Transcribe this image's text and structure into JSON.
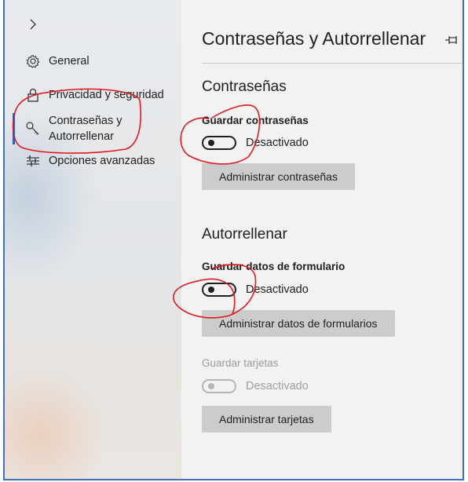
{
  "sidebar": {
    "items": [
      {
        "label": "General",
        "icon": "gear-icon"
      },
      {
        "label": "Privacidad y seguridad",
        "icon": "lock-icon"
      },
      {
        "label": "Contraseñas y",
        "label2": "Autorrellenar",
        "icon": "key-icon",
        "active": true
      },
      {
        "label": "Opciones avanzadas",
        "icon": "sliders-icon"
      }
    ]
  },
  "page": {
    "title": "Contraseñas y Autorrellenar"
  },
  "passwords": {
    "heading": "Contraseñas",
    "save_label": "Guardar contraseñas",
    "toggle_state": "Desactivado",
    "manage_button": "Administrar contraseñas"
  },
  "autofill": {
    "heading": "Autorrellenar",
    "form_label": "Guardar datos de formulario",
    "form_toggle_state": "Desactivado",
    "form_button": "Administrar datos de formularios",
    "cards_label": "Guardar tarjetas",
    "cards_toggle_state": "Desactivado",
    "cards_button": "Administrar tarjetas"
  },
  "colors": {
    "accent": "#1f63c6",
    "annotation": "#e0191b"
  }
}
